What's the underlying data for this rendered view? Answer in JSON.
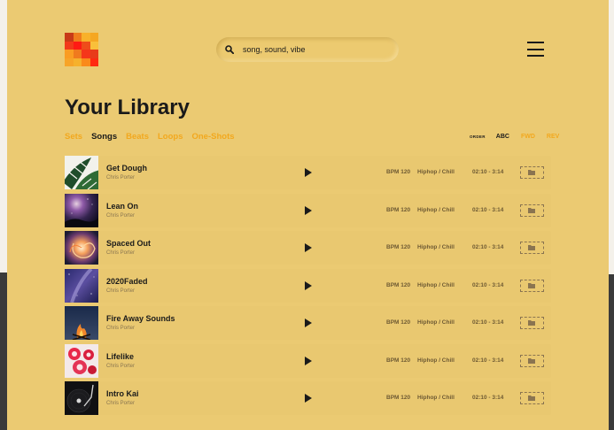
{
  "logo": {
    "colors": [
      "#c83a18",
      "#ef7c1c",
      "#f8b12a",
      "#f5a722",
      "#f23a1a",
      "#ff1a14",
      "#ef4c1a",
      "#f9c03a",
      "#fa9c22",
      "#f07a1e",
      "#f5361a",
      "#e83b1a",
      "#f7a428",
      "#f6b12c",
      "#fa8a1a",
      "#ff2a10"
    ]
  },
  "search": {
    "placeholder": "song, sound, vibe",
    "value": ""
  },
  "page": {
    "title": "Your Library"
  },
  "tabs": [
    {
      "label": "Sets",
      "active": false
    },
    {
      "label": "Songs",
      "active": true
    },
    {
      "label": "Beats",
      "active": false
    },
    {
      "label": "Loops",
      "active": false
    },
    {
      "label": "One-Shots",
      "active": false
    }
  ],
  "order": {
    "label": "ORDER",
    "options": [
      "ABC",
      "FWD",
      "REV"
    ],
    "active": "ABC"
  },
  "colors": {
    "background": "#ebca72",
    "accent": "#f2a81e",
    "text": "#1a1a1a"
  },
  "songs": [
    {
      "title": "Get Dough",
      "artist": "Chris Porter",
      "bpm": "BPM 120",
      "genre": "Hiphop / Chill",
      "duration": "02:10 - 3:14",
      "art": "monstera-leaves"
    },
    {
      "title": "Lean On",
      "artist": "Chris Porter",
      "bpm": "BPM 120",
      "genre": "Hiphop / Chill",
      "duration": "02:10 - 3:14",
      "art": "night-sky"
    },
    {
      "title": "Spaced Out",
      "artist": "Chris Porter",
      "bpm": "BPM 120",
      "genre": "Hiphop / Chill",
      "duration": "02:10 - 3:14",
      "art": "fiery-swirl"
    },
    {
      "title": "2020Faded",
      "artist": "Chris Porter",
      "bpm": "BPM 120",
      "genre": "Hiphop / Chill",
      "duration": "02:10 - 3:14",
      "art": "purple-galaxy"
    },
    {
      "title": "Fire Away Sounds",
      "artist": "Chris Porter",
      "bpm": "BPM 120",
      "genre": "Hiphop / Chill",
      "duration": "02:10 - 3:14",
      "art": "campfire"
    },
    {
      "title": "Lifelike",
      "artist": "Chris Porter",
      "bpm": "BPM 120",
      "genre": "Hiphop / Chill",
      "duration": "02:10 - 3:14",
      "art": "red-fruit"
    },
    {
      "title": "Intro Kai",
      "artist": "Chris Porter",
      "bpm": "BPM 120",
      "genre": "Hiphop / Chill",
      "duration": "02:10 - 3:14",
      "art": "turntable"
    }
  ]
}
